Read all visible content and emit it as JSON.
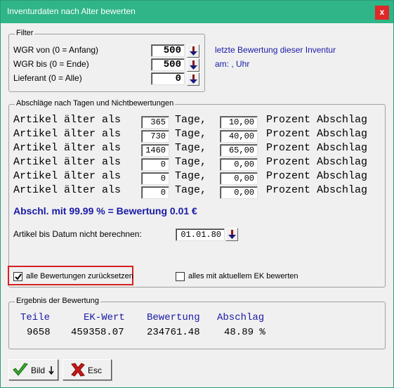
{
  "window": {
    "title": "Inventurdaten nach Alter bewerten",
    "close_label": "x"
  },
  "filter": {
    "legend": "Filter",
    "wgr_von_label": "WGR von (0 = Anfang)",
    "wgr_von_value": "500",
    "wgr_bis_label": "WGR bis (0 = Ende)",
    "wgr_bis_value": "500",
    "lieferant_label": "Lieferant (0 = Alle)",
    "lieferant_value": "0",
    "info_line1": "letzte Bewertung dieser Inventur",
    "info_line2": "am:  ,  Uhr"
  },
  "abschlaege": {
    "legend": "Abschläge nach Tagen und Nichtbewertungen",
    "row_prefix": "Artikel älter als",
    "row_mid": "Tage,",
    "row_suffix": "Prozent Abschlag",
    "rows": [
      {
        "days": "365",
        "percent": "10,00"
      },
      {
        "days": "730",
        "percent": "40,00"
      },
      {
        "days": "1460",
        "percent": "65,00"
      },
      {
        "days": "0",
        "percent": "0,00"
      },
      {
        "days": "0",
        "percent": "0,00"
      },
      {
        "days": "0",
        "percent": "0,00"
      }
    ],
    "summary": "Abschl. mit 99.99 % = Bewertung 0.01  €",
    "datum_label": "Artikel bis Datum nicht berechnen:",
    "datum_value": "01.01.80",
    "reset_label": "alle Bewertungen zurücksetzen",
    "reset_checked": true,
    "aktuell_label": "alles mit aktuellem EK bewerten",
    "aktuell_checked": false
  },
  "ergebnis": {
    "legend": "Ergebnis der Bewertung",
    "headers": [
      "Teile",
      "EK-Wert",
      "Bewertung",
      "Abschlag"
    ],
    "values": [
      "9658",
      "459358.07",
      "234761.48",
      "48.89 %"
    ]
  },
  "buttons": {
    "bild_label": "Bild",
    "esc_label": "Esc"
  },
  "colors": {
    "titlebar": "#2fb588",
    "accent_blue": "#1a1aa6",
    "highlight_red": "#d82020",
    "check_green": "#3aaa2a",
    "esc_red": "#c81818"
  }
}
